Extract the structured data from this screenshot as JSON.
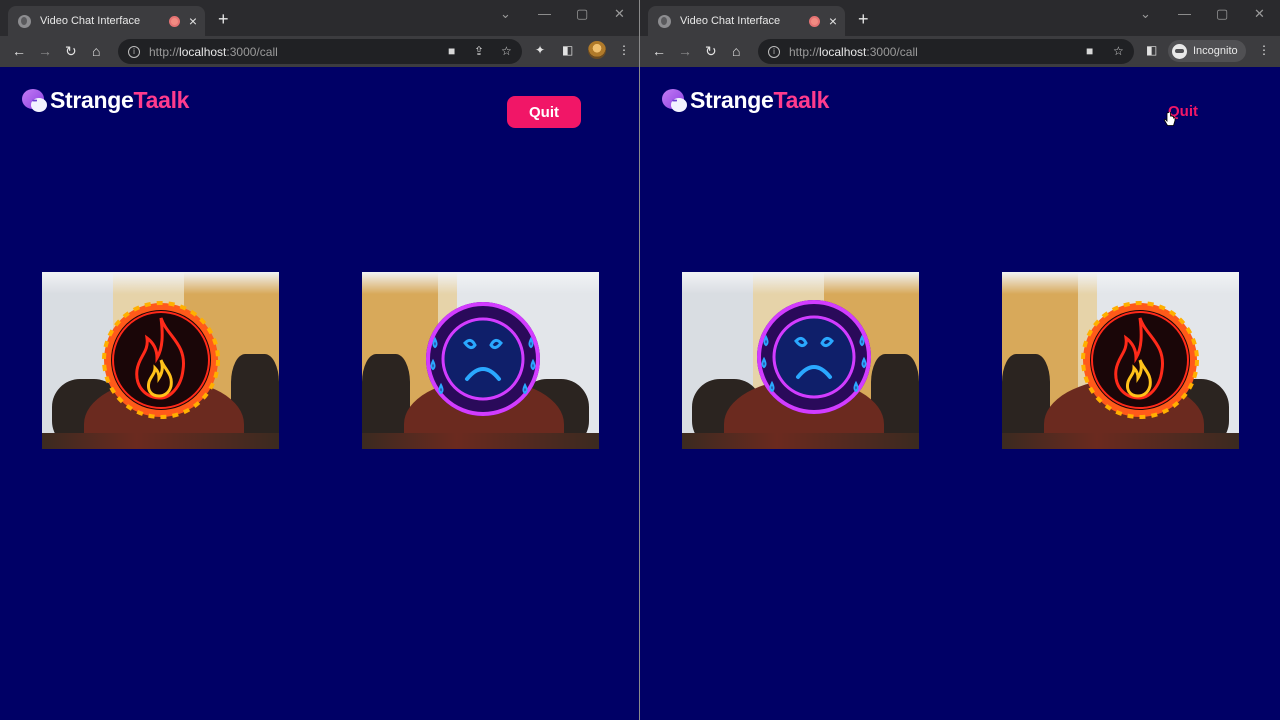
{
  "windows": [
    {
      "id": "left",
      "tab_title": "Video Chat Interface",
      "url_scheme": "http://",
      "url_host": "localhost",
      "url_path": ":3000/call",
      "brand_main": "Strange",
      "brand_accent": "Taalk",
      "quit_label": "Quit",
      "quit_style": "filled-button",
      "tiles": [
        {
          "mask": "fire-mask",
          "mirror": false
        },
        {
          "mask": "sad-face-mask",
          "mirror": true
        }
      ]
    },
    {
      "id": "right",
      "tab_title": "Video Chat Interface",
      "url_scheme": "http://",
      "url_host": "localhost",
      "url_path": ":3000/call",
      "incognito_label": "Incognito",
      "brand_main": "Strange",
      "brand_accent": "Taalk",
      "quit_label": "Quit",
      "quit_style": "hover-text",
      "tiles": [
        {
          "mask": "sad-face-mask",
          "mirror": false
        },
        {
          "mask": "fire-mask",
          "mirror": true
        }
      ]
    }
  ],
  "colors": {
    "page_background": "#000066",
    "accent_pink": "#f11667",
    "brand_accent": "#ff3b8d",
    "fire_red": "#ff2a1a",
    "neon_magenta": "#d23cff",
    "neon_blue": "#2aa8ff"
  },
  "icons": {
    "back": "←",
    "forward": "→",
    "reload": "↻",
    "home": "⌂",
    "close": "×",
    "new_tab": "+",
    "minimize": "—",
    "maximize": "▢",
    "window_close": "✕",
    "star": "☆",
    "menu": "⋮",
    "extensions": "✦",
    "sidebar": "◧",
    "camera": "■",
    "share": "⇪",
    "tab_search": "⌄"
  }
}
